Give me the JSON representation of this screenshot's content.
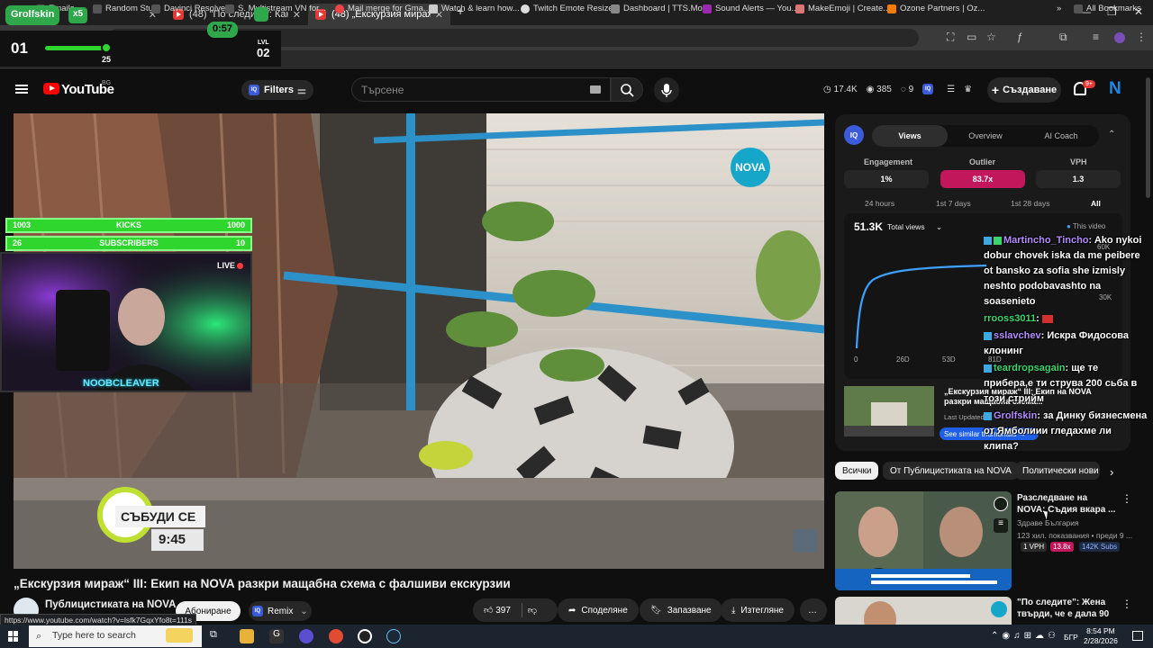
{
  "browser": {
    "tabs": [
      {
        "title": "Grolfskin"
      },
      {
        "title": "(48) \"По следите\": Кандидат..."
      },
      {
        "title": "(48) „Екскурзия мираж“ III:..."
      }
    ],
    "new_tab": "+",
    "url": "youtube.com/watch?v=...",
    "bookmarks": [
      "Emails",
      "Random Stuff",
      "Davinci Resolve",
      "S. Multistream VN for...",
      "Mail merge for Gma...",
      "Watch & learn how...",
      "Twitch Emote Resizer",
      "Dashboard | TTS.Mo...",
      "Sound Alerts — You...",
      "MakeEmoji | Create...",
      "Ozone Partners | Oz...",
      "All Bookmarks"
    ],
    "status_url": "https://www.youtube.com/watch?v=lsfk7GqxYfo8t=111s"
  },
  "youtube": {
    "logo_text": "YouTube",
    "country": "BG",
    "filters_label": "Filters",
    "search_placeholder": "Търсене",
    "stats": {
      "views": "17.4K",
      "likes": "385",
      "count": "9"
    },
    "create_label": "Създаване",
    "notif_badge": "9+"
  },
  "overlay": {
    "name": "Grolfskin",
    "multiplier": "x5",
    "timer": "0:57",
    "level_left": "01",
    "level_mid": "25",
    "lvl_label": "LVL",
    "level_right": "02",
    "kicks": {
      "left": "1003",
      "label": "KICKS",
      "right": "1000"
    },
    "subs": {
      "left": "26",
      "label": "SUBSCRIBERS",
      "right": "10"
    },
    "live": "LIVE",
    "cam_name": "NOOBCLEAVER",
    "nova": "NOVA",
    "subscribe_text": "СЪБУДИ СЕ",
    "subscribe_time": "9:45"
  },
  "video": {
    "title": "„Екскурзия мираж“ III: Екип на NOVA разкри мащабна схема с фалшиви екскурзии",
    "channel": "Публицистиката на NOVA",
    "subscribe": "Абониране",
    "remix": "Remix",
    "likes": "397",
    "share": "Споделяне",
    "save": "Запазване",
    "download": "Изтегляне",
    "more": "…"
  },
  "iq": {
    "logo": "IQ",
    "tabs": [
      "Views",
      "Overview",
      "AI Coach"
    ],
    "metrics": [
      {
        "label": "Engagement",
        "value": "1%"
      },
      {
        "label": "Outlier",
        "value": "83.7x"
      },
      {
        "label": "VPH",
        "value": "1.3"
      }
    ],
    "ranges": [
      "24 hours",
      "1st 7 days",
      "1st 28 days",
      "All"
    ],
    "total": "51.3K",
    "total_label": "Total views",
    "this_video": "This video",
    "x_ticks": [
      "0",
      "26D",
      "53D",
      "81D"
    ],
    "y_ticks": [
      "60K",
      "30K"
    ],
    "similar_title": "„Екскурзия мираж“ III: Екип на NOVA разкри мащабна схема...",
    "last_updated": "Last Updated",
    "similar_btn": "See similar thumbnails →",
    "accent": "#c2185b"
  },
  "chat": [
    {
      "user": "Martincho_Tincho",
      "text": ": Ako nykoi dobur chovek iska da me peibere ot bansko za sofia she izmisly neshto podobavashto na soasenieto"
    },
    {
      "user": "rrooss3011",
      "text": ":"
    },
    {
      "user": "sslavchev",
      "text": ": Искра Фидосова клонинг"
    },
    {
      "user": "teardropsagain",
      "text": ": ще те прибера,е ти струва 200 сьба в този стрийм"
    },
    {
      "user": "Grolfskin",
      "text": ": за Динку бизнесмена от Ямболиии гледахме ли клипа?"
    }
  ],
  "chips": [
    "Всички",
    "От Публицистиката на NOVA",
    "Политически нови"
  ],
  "recs": [
    {
      "title": "Разследване на NOVA: Съдия вкара ...",
      "channel": "Здраве България",
      "meta": "123 хил. показвания • преди 9 ...",
      "vph": "1 VPH",
      "outlier": "13.8x",
      "subs": "142K Subs"
    },
    {
      "title": "\"По следите\": Жена твърди, че е дала 90 0..."
    }
  ],
  "taskbar": {
    "search": "Type here to search",
    "lang": "БГР",
    "time": "8:54 PM",
    "date": "2/28/2026"
  }
}
